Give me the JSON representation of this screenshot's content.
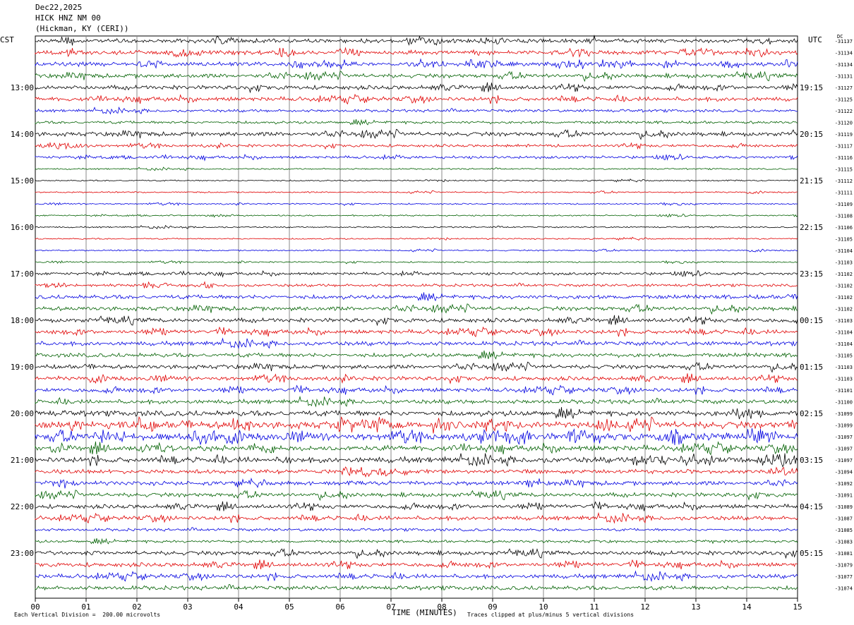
{
  "header": {
    "date": "Dec22,2025",
    "station": "HICK HNZ NM 00",
    "location": "(Hickman, KY (CERI))"
  },
  "left_tz": "CST",
  "right_tz": "UTC",
  "dc_label": "DC",
  "footer": {
    "scale": "Each Vertical Division =  200.00 microvolts",
    "xlabel": "TIME (MINUTES)",
    "clip_note": "Traces clipped at plus/minus 5 vertical divisions"
  },
  "colors": [
    "#000000",
    "#e00000",
    "#0000e0",
    "#006000"
  ],
  "chart_data": {
    "type": "line",
    "description": "helicorder",
    "x_ticks": [
      "00",
      "01",
      "02",
      "03",
      "04",
      "05",
      "06",
      "07",
      "08",
      "09",
      "10",
      "11",
      "12",
      "13",
      "14",
      "15"
    ],
    "xlim": [
      0,
      15
    ],
    "left_hour_labels": [
      "13:00",
      "14:00",
      "15:00",
      "16:00",
      "17:00",
      "18:00",
      "19:00",
      "20:00",
      "21:00",
      "22:00",
      "23:00"
    ],
    "right_hour_labels": [
      "19:15",
      "20:15",
      "21:15",
      "22:15",
      "23:15",
      "00:15",
      "01:15",
      "02:15",
      "03:15",
      "04:15",
      "05:15"
    ],
    "dc_offsets": [
      -31137,
      -31134,
      -31134,
      -31131,
      -31127,
      -31125,
      -31122,
      -31120,
      -31119,
      -31117,
      -31116,
      -31115,
      -31112,
      -31111,
      -31109,
      -31108,
      -31106,
      -31105,
      -31104,
      -31103,
      -31102,
      -31102,
      -31102,
      -31102,
      -31103,
      -31104,
      -31104,
      -31105,
      -31103,
      -31103,
      -31101,
      -31100,
      -31099,
      -31099,
      -31097,
      -31097,
      -31097,
      -31094,
      -31092,
      -31091,
      -31089,
      -31087,
      -31085,
      -31083,
      -31081,
      -31079,
      -31077,
      -31074
    ],
    "trace_amplitude": [
      3,
      3,
      3,
      3,
      3,
      3,
      2,
      2,
      3,
      2,
      2,
      1,
      1,
      1,
      1,
      1,
      1,
      1,
      1,
      1,
      2,
      2,
      3,
      3,
      3,
      3,
      3,
      3,
      3,
      3,
      3,
      3,
      4,
      5,
      5,
      4,
      4,
      3,
      3,
      3,
      3,
      3,
      2,
      2,
      3,
      3,
      3,
      3
    ]
  }
}
